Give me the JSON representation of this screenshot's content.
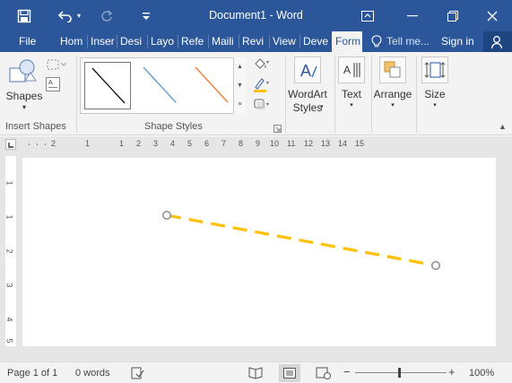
{
  "window": {
    "title": "Document1 - Word"
  },
  "quick_access": {
    "save_icon": "save-icon",
    "undo_icon": "undo-icon",
    "redo_icon": "redo-icon",
    "customize_icon": "customize-icon"
  },
  "tabs": [
    {
      "label": "File"
    },
    {
      "label": "Hom"
    },
    {
      "label": "Inser"
    },
    {
      "label": "Desi"
    },
    {
      "label": "Layo"
    },
    {
      "label": "Refe"
    },
    {
      "label": "Maili"
    },
    {
      "label": "Revi"
    },
    {
      "label": "View"
    },
    {
      "label": "Deve"
    },
    {
      "label": "Form"
    }
  ],
  "tell_me": "Tell me...",
  "sign_in": "Sign in",
  "ribbon": {
    "insert_shapes": {
      "shapes_label": "Shapes",
      "group_label": "Insert Shapes"
    },
    "shape_styles": {
      "group_label": "Shape Styles"
    },
    "wordart": {
      "line1": "WordArt",
      "line2": "Styles"
    },
    "text": {
      "label": "Text"
    },
    "arrange": {
      "label": "Arrange"
    },
    "size": {
      "label": "Size"
    }
  },
  "ruler": {
    "h_numbers": [
      "2",
      "1",
      "1",
      "2",
      "3",
      "4",
      "5",
      "6",
      "7",
      "8",
      "9",
      "10",
      "11",
      "12",
      "13",
      "14",
      "15"
    ],
    "v_numbers": [
      "1",
      "1",
      "2",
      "3",
      "4",
      "5"
    ]
  },
  "status": {
    "page": "Page 1 of 1",
    "words": "0 words",
    "zoom": "100%",
    "zoom_minus": "−",
    "zoom_plus": "+"
  },
  "colors": {
    "title_blue": "#2b579a",
    "shape_line": "#ffc000",
    "handle": "#8a8a8a"
  }
}
